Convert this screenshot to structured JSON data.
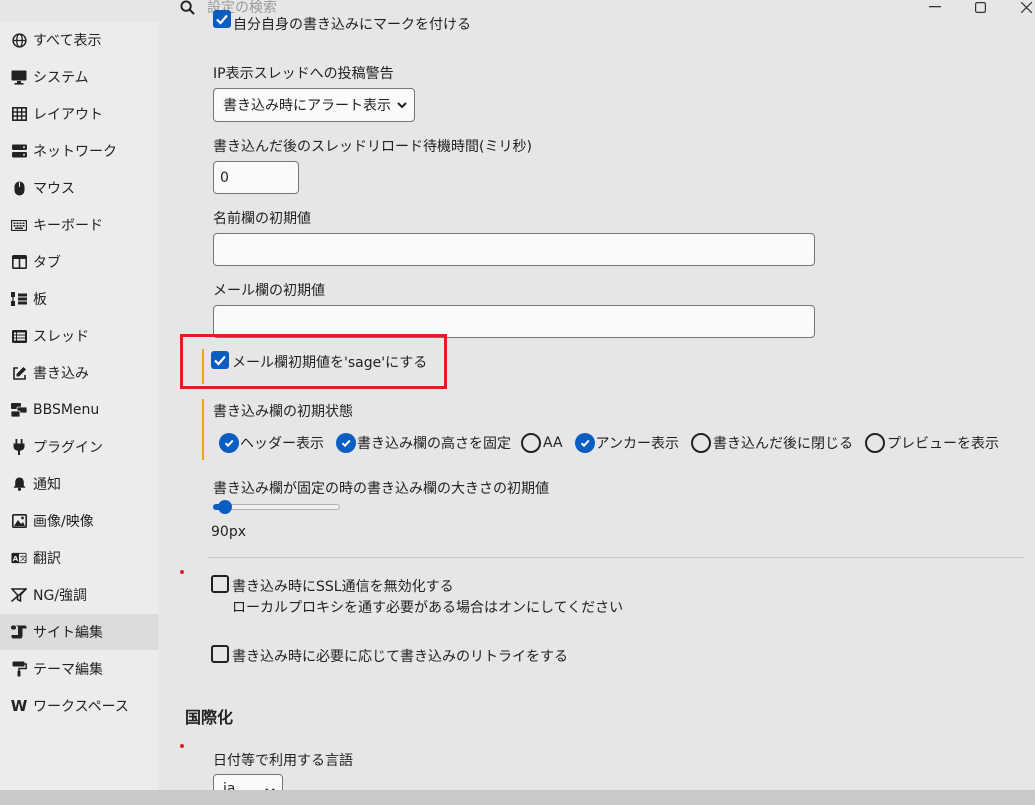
{
  "search": {
    "placeholder": "設定の検索"
  },
  "window": {
    "minimize": "—",
    "maximize": "☐",
    "close": "✕"
  },
  "sidebar": {
    "items": [
      {
        "label": "すべて表示",
        "icon": "globe-icon"
      },
      {
        "label": "システム",
        "icon": "monitor-icon"
      },
      {
        "label": "レイアウト",
        "icon": "grid-icon"
      },
      {
        "label": "ネットワーク",
        "icon": "server-icon"
      },
      {
        "label": "マウス",
        "icon": "mouse-icon"
      },
      {
        "label": "キーボード",
        "icon": "keyboard-icon"
      },
      {
        "label": "タブ",
        "icon": "tab-icon"
      },
      {
        "label": "板",
        "icon": "sitemap-icon"
      },
      {
        "label": "スレッド",
        "icon": "list-icon"
      },
      {
        "label": "書き込み",
        "icon": "edit-icon"
      },
      {
        "label": "BBSMenu",
        "icon": "bbsmenu-icon"
      },
      {
        "label": "プラグイン",
        "icon": "plug-icon"
      },
      {
        "label": "通知",
        "icon": "bell-icon"
      },
      {
        "label": "画像/映像",
        "icon": "image-icon"
      },
      {
        "label": "翻訳",
        "icon": "translate-icon"
      },
      {
        "label": "NG/強調",
        "icon": "filter-icon"
      },
      {
        "label": "サイト編集",
        "icon": "scroll-icon",
        "active": true
      },
      {
        "label": "テーマ編集",
        "icon": "paint-roller-icon"
      },
      {
        "label": "ワークスペース",
        "icon": "w-icon"
      }
    ]
  },
  "main": {
    "top_partial_label": "自分自身の書き込みにマークを付ける",
    "ip_warning": {
      "label": "IP表示スレッドへの投稿警告",
      "value": "書き込み時にアラート表示"
    },
    "reload_wait": {
      "label": "書き込んだ後のスレッドリロード待機時間(ミリ秒)",
      "value": "0"
    },
    "name_default": {
      "label": "名前欄の初期値",
      "value": ""
    },
    "mail_default": {
      "label": "メール欄の初期値",
      "value": ""
    },
    "sage_checkbox": {
      "label": "メール欄初期値を'sage'にする",
      "checked": true
    },
    "post_state": {
      "label": "書き込み欄の初期状態",
      "options": [
        {
          "label": "ヘッダー表示",
          "checked": true
        },
        {
          "label": "書き込み欄の高さを固定",
          "checked": true
        },
        {
          "label": "AA",
          "checked": false
        },
        {
          "label": "アンカー表示",
          "checked": true
        },
        {
          "label": "書き込んだ後に閉じる",
          "checked": false
        },
        {
          "label": "プレビューを表示",
          "checked": false
        }
      ]
    },
    "fixed_size": {
      "label": "書き込み欄が固定の時の書き込み欄の大きさの初期値",
      "value_text": "90px",
      "fraction": 0.08
    },
    "ssl_disable": {
      "label": "書き込み時にSSL通信を無効化する",
      "description": "ローカルプロキシを通す必要がある場合はオンにしてください",
      "checked": false
    },
    "retry": {
      "label": "書き込み時に必要に応じて書き込みのリトライをする",
      "checked": false
    },
    "i18n": {
      "heading": "国際化",
      "lang_label": "日付等で利用する言語",
      "lang_value": "ja"
    }
  },
  "colors": {
    "accent": "#0a5ec2",
    "highlight_border": "#e02020",
    "group_bar": "#f0a020"
  }
}
